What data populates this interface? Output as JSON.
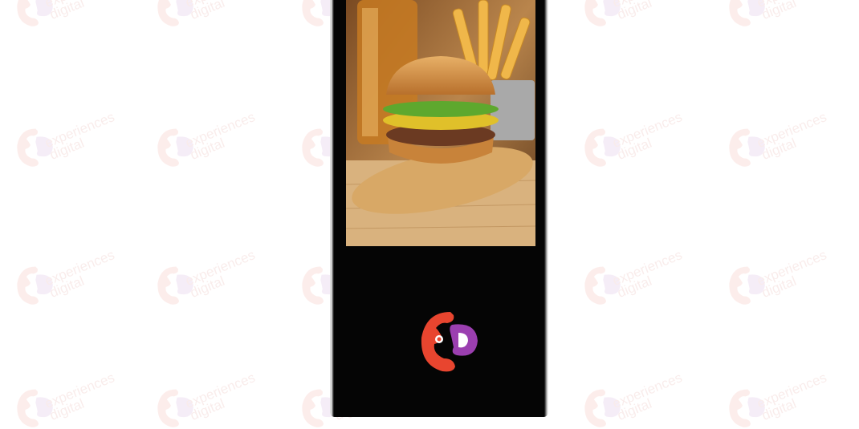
{
  "watermark": {
    "line1": "experiences",
    "line2": "digital",
    "color": "#e74c3c"
  },
  "screen_content": {
    "subject": "burger-and-fries-advert"
  },
  "brand_logo": {
    "primary_color": "#e8452f",
    "secondary_color": "#9b3fb0"
  }
}
